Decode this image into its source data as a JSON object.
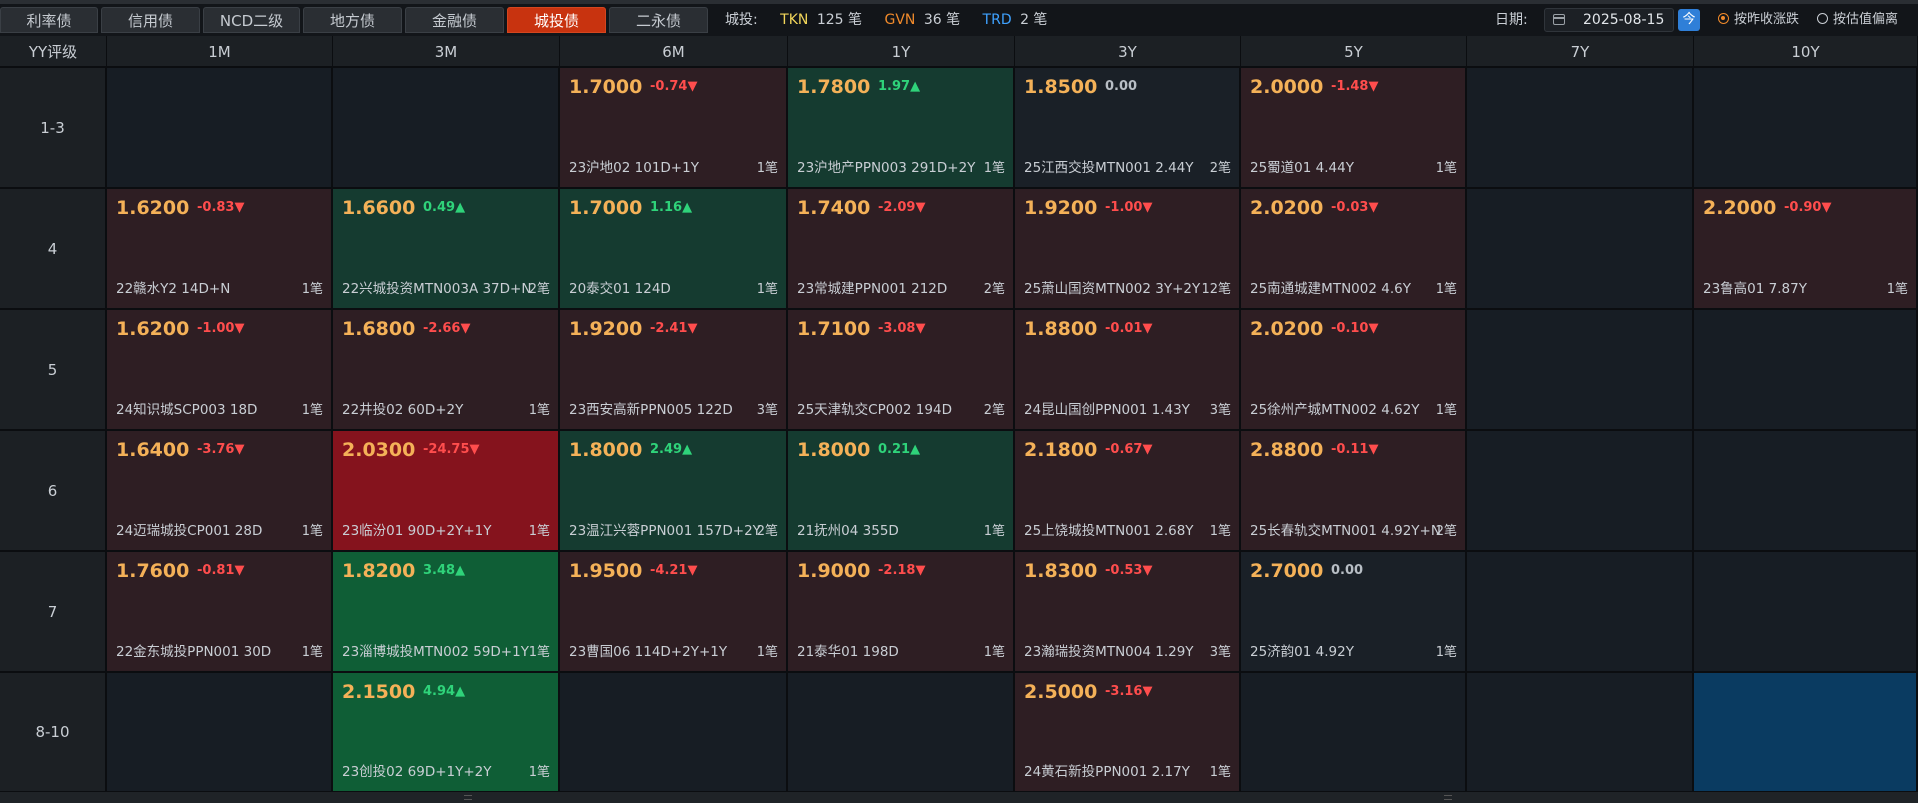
{
  "tabs": [
    {
      "label": "利率债",
      "active": false
    },
    {
      "label": "信用债",
      "active": false
    },
    {
      "label": "NCD二级",
      "active": false
    },
    {
      "label": "地方债",
      "active": false
    },
    {
      "label": "金融债",
      "active": false
    },
    {
      "label": "城投债",
      "active": true
    },
    {
      "label": "二永债",
      "active": false
    }
  ],
  "summary": {
    "label": "城投:",
    "items": [
      {
        "key": "TKN",
        "value": "125 笔",
        "color": "#f2d65a"
      },
      {
        "key": "GVN",
        "value": "36 笔",
        "color": "#f08a2b"
      },
      {
        "key": "TRD",
        "value": "2 笔",
        "color": "#3fa2ff"
      }
    ]
  },
  "date": {
    "label": "日期:",
    "value": "2025-08-15",
    "today_label": "今"
  },
  "radios": [
    {
      "label": "按昨收涨跌",
      "checked": true
    },
    {
      "label": "按估值偏离",
      "checked": false
    }
  ],
  "grid": {
    "corner": "YY评级",
    "columns": [
      "1M",
      "3M",
      "6M",
      "1Y",
      "3Y",
      "5Y",
      "7Y",
      "10Y"
    ],
    "rows": [
      {
        "label": "1-3",
        "cells": [
          null,
          null,
          {
            "rate": "1.7000",
            "change": "-0.74▼",
            "dir": "down",
            "bond": "23沪地02 101D+1Y",
            "count": "1笔",
            "tone": "neg"
          },
          {
            "rate": "1.7800",
            "change": "1.97▲",
            "dir": "up",
            "bond": "23沪地产PPN003 291D+2Y",
            "count": "1笔",
            "tone": "pos"
          },
          {
            "rate": "1.8500",
            "change": "0.00",
            "dir": "zero",
            "bond": "25江西交投MTN001 2.44Y",
            "count": "2笔",
            "tone": "flat"
          },
          {
            "rate": "2.0000",
            "change": "-1.48▼",
            "dir": "down",
            "bond": "25蜀道01 4.44Y",
            "count": "1笔",
            "tone": "neg"
          },
          null,
          null
        ]
      },
      {
        "label": "4",
        "cells": [
          {
            "rate": "1.6200",
            "change": "-0.83▼",
            "dir": "down",
            "bond": "22赣水Y2 14D+N",
            "count": "1笔",
            "tone": "neg"
          },
          {
            "rate": "1.6600",
            "change": "0.49▲",
            "dir": "up",
            "bond": "22兴城投资MTN003A 37D+N",
            "count": "2笔",
            "tone": "pos"
          },
          {
            "rate": "1.7000",
            "change": "1.16▲",
            "dir": "up",
            "bond": "20泰交01 124D",
            "count": "1笔",
            "tone": "pos"
          },
          {
            "rate": "1.7400",
            "change": "-2.09▼",
            "dir": "down",
            "bond": "23常城建PPN001 212D",
            "count": "2笔",
            "tone": "neg"
          },
          {
            "rate": "1.9200",
            "change": "-1.00▼",
            "dir": "down",
            "bond": "25萧山国资MTN002 3Y+2Y",
            "count": "12笔",
            "tone": "neg"
          },
          {
            "rate": "2.0200",
            "change": "-0.03▼",
            "dir": "down",
            "bond": "25南通城建MTN002 4.6Y",
            "count": "1笔",
            "tone": "neg"
          },
          null,
          {
            "rate": "2.2000",
            "change": "-0.90▼",
            "dir": "down",
            "bond": "23鲁高01 7.87Y",
            "count": "1笔",
            "tone": "neg"
          }
        ]
      },
      {
        "label": "5",
        "cells": [
          {
            "rate": "1.6200",
            "change": "-1.00▼",
            "dir": "down",
            "bond": "24知识城SCP003 18D",
            "count": "1笔",
            "tone": "neg"
          },
          {
            "rate": "1.6800",
            "change": "-2.66▼",
            "dir": "down",
            "bond": "22井投02 60D+2Y",
            "count": "1笔",
            "tone": "neg"
          },
          {
            "rate": "1.9200",
            "change": "-2.41▼",
            "dir": "down",
            "bond": "23西安高新PPN005 122D",
            "count": "3笔",
            "tone": "neg"
          },
          {
            "rate": "1.7100",
            "change": "-3.08▼",
            "dir": "down",
            "bond": "25天津轨交CP002 194D",
            "count": "2笔",
            "tone": "neg"
          },
          {
            "rate": "1.8800",
            "change": "-0.01▼",
            "dir": "down",
            "bond": "24昆山国创PPN001 1.43Y",
            "count": "3笔",
            "tone": "neg"
          },
          {
            "rate": "2.0200",
            "change": "-0.10▼",
            "dir": "down",
            "bond": "25徐州产城MTN002 4.62Y",
            "count": "1笔",
            "tone": "neg"
          },
          null,
          null
        ]
      },
      {
        "label": "6",
        "cells": [
          {
            "rate": "1.6400",
            "change": "-3.76▼",
            "dir": "down",
            "bond": "24迈瑞城投CP001 28D",
            "count": "1笔",
            "tone": "neg"
          },
          {
            "rate": "2.0300",
            "change": "-24.75▼",
            "dir": "down",
            "bond": "23临汾01 90D+2Y+1Y",
            "count": "1笔",
            "tone": "strongneg"
          },
          {
            "rate": "1.8000",
            "change": "2.49▲",
            "dir": "up",
            "bond": "23温江兴蓉PPN001 157D+2Y",
            "count": "2笔",
            "tone": "pos"
          },
          {
            "rate": "1.8000",
            "change": "0.21▲",
            "dir": "up",
            "bond": "21抚州04 355D",
            "count": "1笔",
            "tone": "pos"
          },
          {
            "rate": "2.1800",
            "change": "-0.67▼",
            "dir": "down",
            "bond": "25上饶城投MTN001 2.68Y",
            "count": "1笔",
            "tone": "neg"
          },
          {
            "rate": "2.8800",
            "change": "-0.11▼",
            "dir": "down",
            "bond": "25长春轨交MTN001 4.92Y+N",
            "count": "2笔",
            "tone": "neg"
          },
          null,
          null
        ]
      },
      {
        "label": "7",
        "cells": [
          {
            "rate": "1.7600",
            "change": "-0.81▼",
            "dir": "down",
            "bond": "22金东城投PPN001 30D",
            "count": "1笔",
            "tone": "neg"
          },
          {
            "rate": "1.8200",
            "change": "3.48▲",
            "dir": "up",
            "bond": "23淄博城投MTN002 59D+1Y",
            "count": "1笔",
            "tone": "strongpos"
          },
          {
            "rate": "1.9500",
            "change": "-4.21▼",
            "dir": "down",
            "bond": "23曹国06 114D+2Y+1Y",
            "count": "1笔",
            "tone": "neg"
          },
          {
            "rate": "1.9000",
            "change": "-2.18▼",
            "dir": "down",
            "bond": "21泰华01 198D",
            "count": "1笔",
            "tone": "neg"
          },
          {
            "rate": "1.8300",
            "change": "-0.53▼",
            "dir": "down",
            "bond": "23瀚瑞投资MTN004 1.29Y",
            "count": "3笔",
            "tone": "neg"
          },
          {
            "rate": "2.7000",
            "change": "0.00",
            "dir": "zero",
            "bond": "25济韵01 4.92Y",
            "count": "1笔",
            "tone": "flat"
          },
          null,
          null
        ]
      },
      {
        "label": "8-10",
        "cells": [
          null,
          {
            "rate": "2.1500",
            "change": "4.94▲",
            "dir": "up",
            "bond": "23创投02 69D+1Y+2Y",
            "count": "1笔",
            "tone": "strongpos"
          },
          null,
          null,
          {
            "rate": "2.5000",
            "change": "-3.16▼",
            "dir": "down",
            "bond": "24黄石新投PPN001 2.17Y",
            "count": "1笔",
            "tone": "neg"
          },
          null,
          null,
          {
            "selected": true
          }
        ]
      }
    ]
  }
}
